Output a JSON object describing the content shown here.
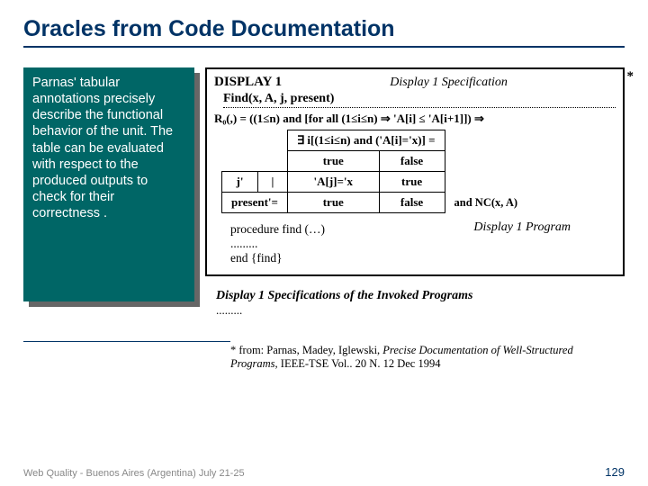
{
  "title": "Oracles from Code Documentation",
  "sidebox": "Parnas' tabular annotations precisely describe the functional behavior of the unit. The table can be evaluated with respect to the produced outputs to check for their correctness .",
  "display": {
    "label": "DISPLAY 1",
    "subtitle": "Display 1 Specification",
    "asterisk": "*",
    "find_signature": "Find(x, A, j, present)",
    "r0_line": "R₀(,) = ((1≤n) and [for all (1≤i≤n) ⇒ 'A[i] ≤ 'A[i+1]]) ⇒",
    "table": {
      "header_span": "∃ i[(1≤i≤n) and ('A[i]='x)] =",
      "col_true": "true",
      "col_false": "false",
      "row_j_label": "j'",
      "row_j_sep": "|",
      "row_j_true": "'A[j]='x",
      "row_j_false": "true",
      "row_present_label": "present'=",
      "row_present_true": "true",
      "row_present_false": "false",
      "nc": "and NC(x, A)"
    },
    "program_label": "Display 1 Program",
    "proc1": "procedure find (…)",
    "proc_dots": ".........",
    "proc_end": "end {find}"
  },
  "invoked": "Display 1 Specifications of the Invoked Programs",
  "invoked_dots": ".........",
  "citation": {
    "lead": "* from: Parnas, Madey, Iglewski, ",
    "title_it": "Precise Documentation of Well-Structured Programs",
    "tail": ", IEEE-TSE Vol.. 20 N. 12 Dec 1994"
  },
  "footer": {
    "left": "Web Quality - Buenos Aires (Argentina) July 21-25",
    "right": "129"
  }
}
